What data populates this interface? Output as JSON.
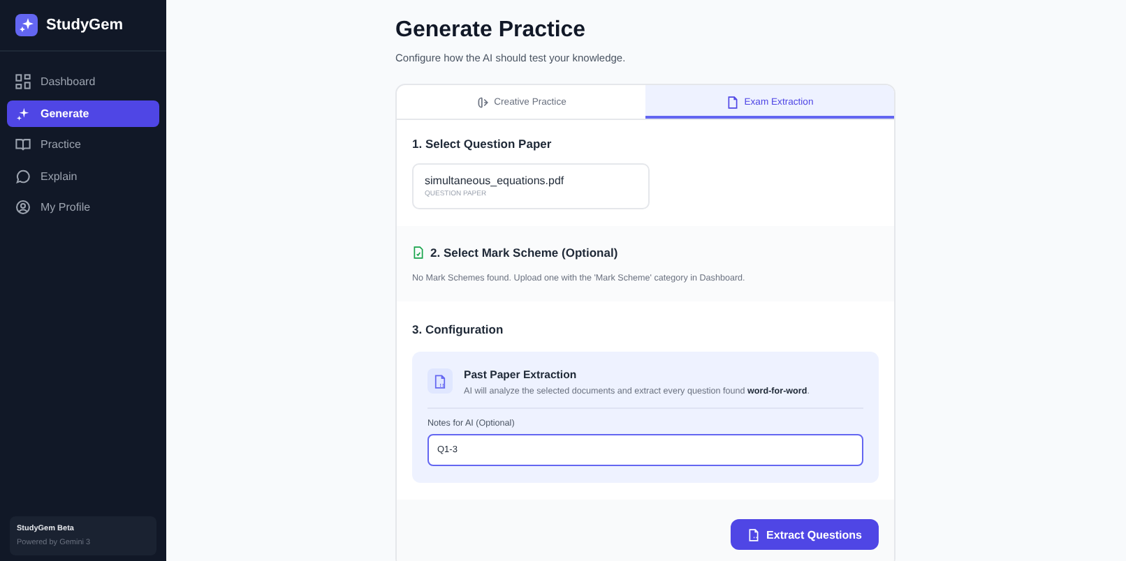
{
  "sidebar": {
    "brand": "StudyGem",
    "items": [
      {
        "label": "Dashboard",
        "selected": false
      },
      {
        "label": "Generate",
        "selected": true
      },
      {
        "label": "Practice",
        "selected": false
      },
      {
        "label": "Explain",
        "selected": false
      },
      {
        "label": "My Profile",
        "selected": false
      }
    ],
    "footer": {
      "title": "StudyGem Beta",
      "subtitle": "Powered by Gemini 3"
    }
  },
  "page": {
    "title": "Generate Practice",
    "subtitle": "Configure how the AI should test your knowledge."
  },
  "tabs": [
    {
      "label": "Creative Practice",
      "selected": false
    },
    {
      "label": "Exam Extraction",
      "selected": true
    }
  ],
  "question_paper": {
    "heading": "1. Select Question Paper",
    "file": {
      "name": "simultaneous_equations.pdf",
      "type": "QUESTION PAPER"
    }
  },
  "mark_scheme": {
    "heading": "2. Select Mark Scheme (Optional)",
    "message": "No Mark Schemes found. Upload one with the 'Mark Scheme' category in Dashboard."
  },
  "configuration": {
    "heading": "3. Configuration",
    "mode_title": "Past Paper Extraction",
    "mode_description": "AI will analyze the selected documents and extract every question found **word-for-word**.",
    "notes_label": "Notes for AI (Optional)",
    "notes_value": "Q1-3"
  },
  "submit_button": "Extract Questions"
}
